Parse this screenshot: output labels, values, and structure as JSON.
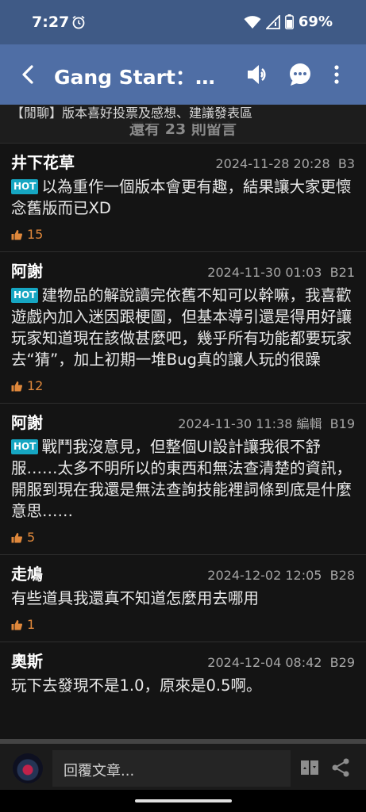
{
  "status_bar": {
    "time": "7:27",
    "battery": "69%"
  },
  "app_bar": {
    "title": "Gang Start：異…"
  },
  "topic": {
    "title": "【閒聊】版本喜好投票及感想、建議發表區",
    "hidden_count_text": "還有 23 則留言"
  },
  "posts": [
    {
      "author": "井下花草",
      "date": "2024-11-28 20:28",
      "edited": "",
      "floor": "B3",
      "badge": "HOT",
      "text": "以為重作一個版本會更有趣，結果讓大家更懷念舊版而已XD",
      "likes": "15"
    },
    {
      "author": "阿謝",
      "date": "2024-11-30 01:03",
      "edited": "",
      "floor": "B21",
      "badge": "HOT",
      "text": "建物品的解說讀完依舊不知可以幹嘛，我喜歡遊戲內加入迷因跟梗圖，但基本導引還是得用好讓玩家知道現在該做甚麼吧，幾乎所有功能都要玩家去“猜”，加上初期一堆Bug真的讓人玩的很躁",
      "likes": "12"
    },
    {
      "author": "阿謝",
      "date": "2024-11-30 11:38",
      "edited": "編輯",
      "floor": "B19",
      "badge": "HOT",
      "text": "戰鬥我沒意見，但整個UI設計讓我很不舒服……太多不明所以的東西和無法查清楚的資訊，開服到現在我還是無法查詢技能裡詞條到底是什麼意思……",
      "likes": "5"
    },
    {
      "author": "走鳩",
      "date": "2024-12-02 12:05",
      "edited": "",
      "floor": "B28",
      "badge": "",
      "text": "有些道具我還真不知道怎麼用去哪用",
      "likes": "1"
    },
    {
      "author": "奧斯",
      "date": "2024-12-04 08:42",
      "edited": "",
      "floor": "B29",
      "badge": "",
      "text": "玩下去發現不是1.0，原來是0.5啊。",
      "likes": ""
    }
  ],
  "reply_bar": {
    "placeholder": "回覆文章..."
  }
}
